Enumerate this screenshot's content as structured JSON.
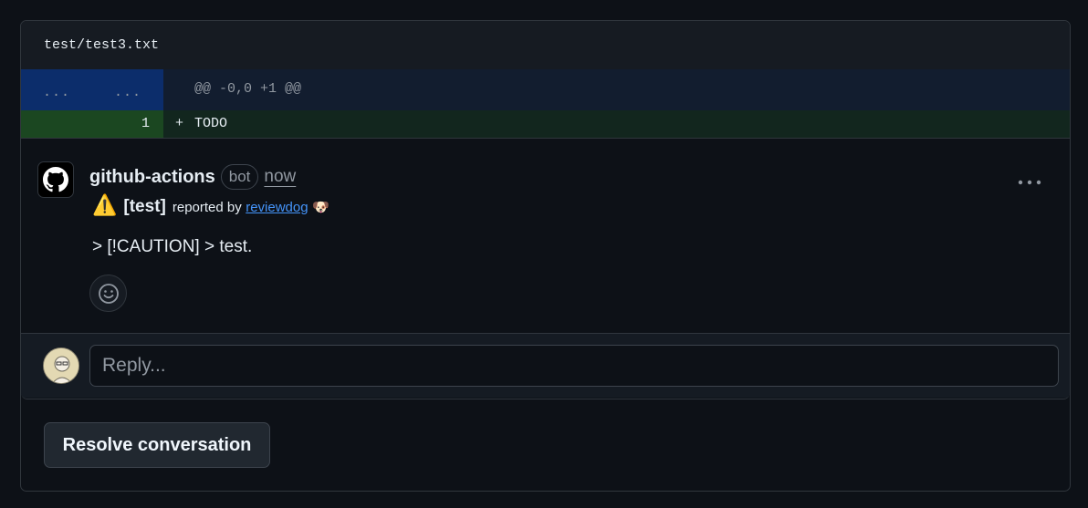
{
  "file": {
    "path": "test/test3.txt"
  },
  "diff": {
    "hunk": {
      "left_num": "...",
      "right_num": "...",
      "header": "@@ -0,0 +1 @@"
    },
    "lines": [
      {
        "num": "1",
        "sign": "+",
        "text": "TODO"
      }
    ]
  },
  "comment": {
    "author": "github-actions",
    "badge": "bot",
    "time": "now",
    "tag": "[test]",
    "reported_by": "reported by",
    "reporter": "reviewdog",
    "reporter_emoji": "🐶",
    "warning_emoji": "⚠️",
    "message": "> [!CAUTION] > test.",
    "more_icon": "kebab-horizontal-icon",
    "reaction_icon": "smiley-icon"
  },
  "reply": {
    "placeholder": "Reply..."
  },
  "actions": {
    "resolve_label": "Resolve conversation"
  },
  "colors": {
    "added_bg": "#12261e",
    "hunk_bg": "#121d2f",
    "link": "#4493f8"
  }
}
